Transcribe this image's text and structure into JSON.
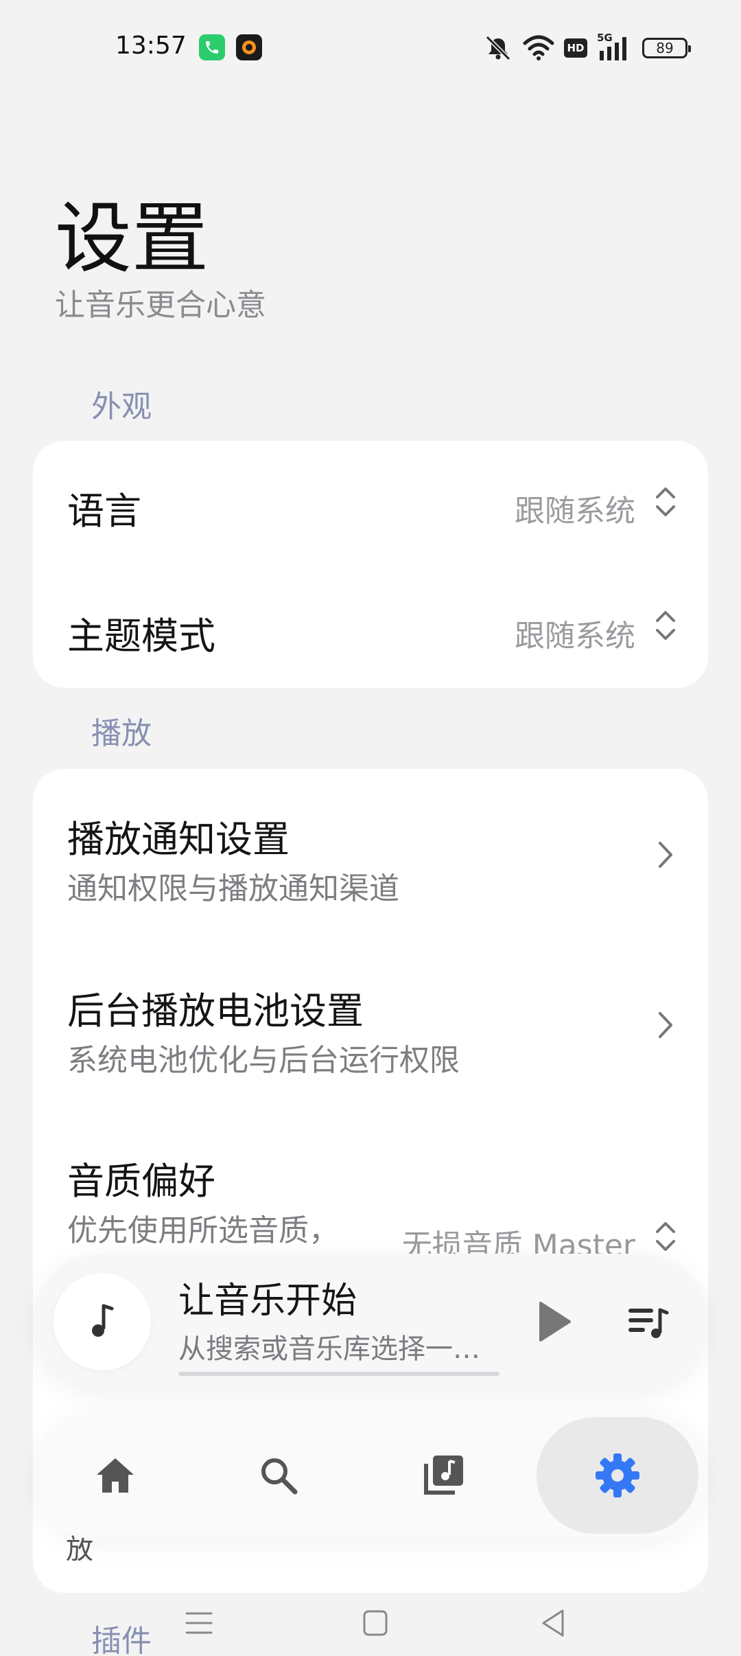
{
  "status_bar": {
    "time": "13:57",
    "battery": "89",
    "network": "5G",
    "hd": "HD"
  },
  "header": {
    "title": "设置",
    "subtitle": "让音乐更合心意"
  },
  "sections": {
    "appearance": {
      "label": "外观",
      "items": [
        {
          "title": "语言",
          "value": "跟随系统"
        },
        {
          "title": "主题模式",
          "value": "跟随系统"
        }
      ]
    },
    "playback": {
      "label": "播放",
      "items": [
        {
          "title": "播放通知设置",
          "subtitle": "通知权限与播放通知渠道"
        },
        {
          "title": "后台播放电池设置",
          "subtitle": "系统电池优化与后台运行权限"
        },
        {
          "title": "音质偏好",
          "subtitle": "优先使用所选音质，",
          "value": "无损音质 Master"
        }
      ],
      "peek_text": "放"
    },
    "plugins": {
      "label": "插件"
    }
  },
  "player": {
    "title": "让音乐开始",
    "subtitle": "从搜索或音乐库选择一…",
    "progress": 0
  },
  "nav": {
    "items": [
      {
        "name": "home",
        "icon": "home-icon"
      },
      {
        "name": "search",
        "icon": "search-icon"
      },
      {
        "name": "library",
        "icon": "music-library-icon"
      },
      {
        "name": "settings",
        "icon": "gear-icon",
        "active": true
      }
    ]
  },
  "colors": {
    "accent": "#3478f6",
    "section_label": "#8790b1",
    "background": "#f3f3f4"
  }
}
